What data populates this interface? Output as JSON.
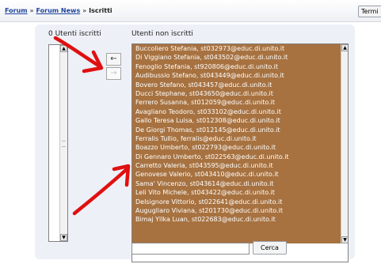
{
  "breadcrumb": {
    "items": [
      "Forum",
      "Forum News"
    ],
    "separator": "»",
    "current": "Iscritti"
  },
  "header": {
    "button_label": "Termi"
  },
  "enrolled": {
    "label": "0 Utenti iscritti"
  },
  "not_enrolled": {
    "label": "Utenti non iscritti",
    "users": [
      "Buccoliero Stefania, st032973@educ.di.unito.it",
      "Di Viggiano Stefania, st043502@educ.di.unito.it",
      "Fenoglio Stefania, st920806@educ.di.unito.it",
      "Audibussio Stefano, st043449@educ.di.unito.it",
      "Bovero Stefano, st043457@educ.di.unito.it",
      "Ducci Stephane, st043650@educ.di.unito.it",
      "Ferrero Susanna, st012059@educ.di.unito.it",
      "Avagliano Teodoro, st033102@educ.di.unito.it",
      "Gallo Teresa Luisa, st012308@educ.di.unito.it",
      "De Giorgi Thomas, st012145@educ.di.unito.it",
      "Ferralis Tullio, ferralis@educ.di.unito.it",
      "Boazzo Umberto, st022793@educ.di.unito.it",
      "Di Gennaro Umberto, st022563@educ.di.unito.it",
      "Carretto Valeria, st043595@educ.di.unito.it",
      "Genovese Valerio, st043410@educ.di.unito.it",
      "Sama' Vincenzo, st043614@educ.di.unito.it",
      "Leli Vito Michele, st043422@educ.di.unito.it",
      "Delsignore Vittorio, st022641@educ.di.unito.it",
      "Augugliaro Viviana, st201730@educ.di.unito.it",
      "Bimaj Yllka Luan, st022683@educ.di.unito.it"
    ],
    "selection_color": "#a77240"
  },
  "actions": {
    "add_symbol": "←",
    "remove_symbol": "→"
  },
  "search": {
    "value": "",
    "button_label": "Cerca"
  },
  "annotation_color": "#e01010"
}
